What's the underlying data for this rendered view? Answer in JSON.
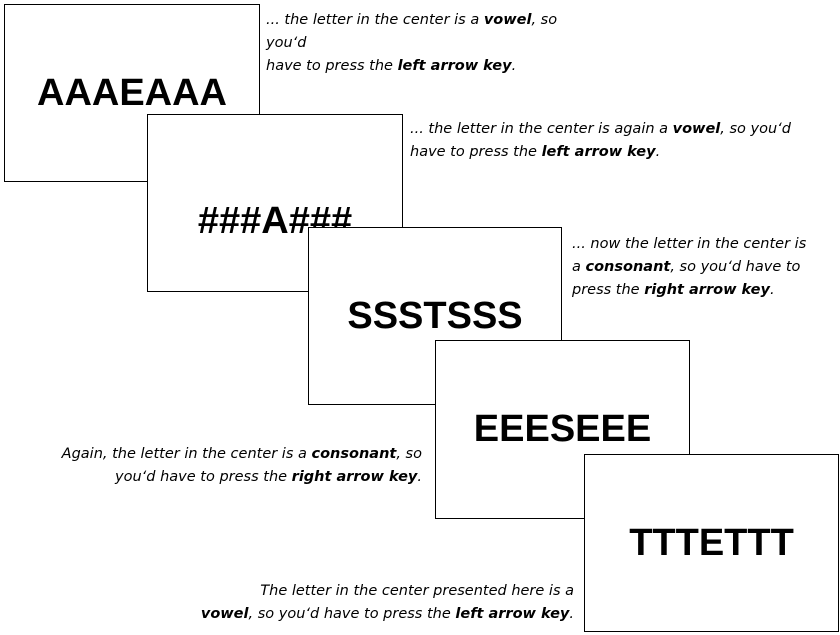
{
  "trials": [
    {
      "stimulus": "AAAEAAA",
      "caption": {
        "lines": [
          [
            {
              "t": "... the letter in the center is a "
            },
            {
              "t": "vowel",
              "b": true
            },
            {
              "t": ", so you‘d"
            }
          ],
          [
            {
              "t": "have to press the "
            },
            {
              "t": "left arrow key",
              "b": true
            },
            {
              "t": "."
            }
          ]
        ]
      }
    },
    {
      "stimulus": "###A###",
      "caption": {
        "lines": [
          [
            {
              "t": "... the letter in the center is again a "
            },
            {
              "t": "vowel",
              "b": true
            },
            {
              "t": ", so you‘d"
            }
          ],
          [
            {
              "t": "have to press the "
            },
            {
              "t": "left arrow key",
              "b": true
            },
            {
              "t": "."
            }
          ]
        ]
      }
    },
    {
      "stimulus": "SSSTSSS",
      "caption": {
        "lines": [
          [
            {
              "t": "... now the letter in the center is"
            }
          ],
          [
            {
              "t": "a "
            },
            {
              "t": "consonant",
              "b": true
            },
            {
              "t": ", so you‘d have to"
            }
          ],
          [
            {
              "t": "press the "
            },
            {
              "t": "right arrow key",
              "b": true
            },
            {
              "t": "."
            }
          ]
        ]
      }
    },
    {
      "stimulus": "EEESEEE",
      "caption": {
        "lines": [
          [
            {
              "t": "Again, the letter in the center is a "
            },
            {
              "t": "consonant",
              "b": true
            },
            {
              "t": ", so"
            }
          ],
          [
            {
              "t": "you‘d have to press the "
            },
            {
              "t": "right arrow key",
              "b": true
            },
            {
              "t": "."
            }
          ]
        ]
      }
    },
    {
      "stimulus": "TTTETTT",
      "caption": {
        "lines": [
          [
            {
              "t": "The letter in the center presented here is a"
            }
          ],
          [
            {
              "t": "vowel",
              "b": true
            },
            {
              "t": ", so you‘d have to press the "
            },
            {
              "t": "left arrow key",
              "b": true
            },
            {
              "t": "."
            }
          ]
        ]
      }
    }
  ]
}
